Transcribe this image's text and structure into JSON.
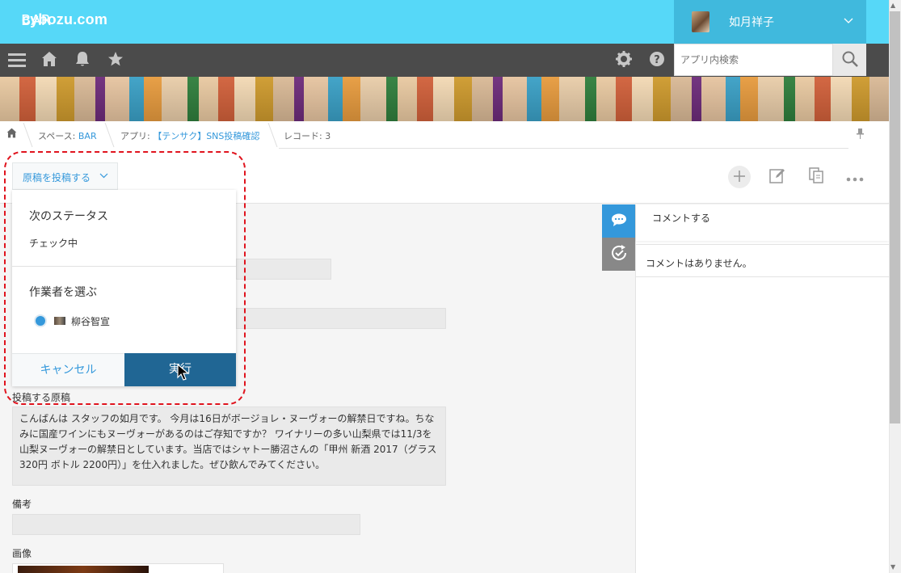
{
  "header": {
    "logo": "cybozu.com",
    "user_name": "如月祥子",
    "search_placeholder": "アプリ内検索",
    "colors": {
      "header_bg": "#56d8f8",
      "user_bg": "#40b9dd",
      "nav_bg": "#4b4b4b"
    }
  },
  "nav_icons": [
    "menu-icon",
    "home-icon",
    "bell-icon",
    "star-icon",
    "gear-icon",
    "help-icon"
  ],
  "banner": {
    "title": "BAR"
  },
  "breadcrumb": {
    "space_prefix": "スペース: ",
    "space": "BAR",
    "app_prefix": "アプリ: ",
    "app": "【テンサク】SNS投稿確認",
    "record": "レコード: 3"
  },
  "toolbar": {
    "status_button": "原稿を投稿する",
    "actions": [
      "add-icon",
      "edit-icon",
      "copy-icon",
      "more-icon"
    ]
  },
  "popup": {
    "next_status_title": "次のステータス",
    "next_status_value": "チェック中",
    "assignee_title": "作業者を選ぶ",
    "assignee_name": "柳谷智宣",
    "cancel": "キャンセル",
    "execute": "実行"
  },
  "form": {
    "post_label": "投稿する原稿",
    "post_text": "こんばんは スタッフの如月です。 今月は16日がボージョレ・ヌーヴォーの解禁日ですね。ちなみに国産ワインにもヌーヴォーがあるのはご存知ですか？ ワイナリーの多い山梨県では11/3を山梨ヌーヴォーの解禁日としています。当店ではシャトー勝沼さんの「甲州 新酒 2017（グラス 320円 ボトル 2200円）」を仕入れました。ぜひ飲んでみてください。",
    "notes_label": "備考",
    "image_label": "画像"
  },
  "sidebar": {
    "comment_placeholder": "コメントする",
    "no_comments": "コメントはありません。"
  },
  "colors": {
    "accent": "#3498db",
    "execute_bg": "#206694",
    "highlight": "#e0141e"
  }
}
